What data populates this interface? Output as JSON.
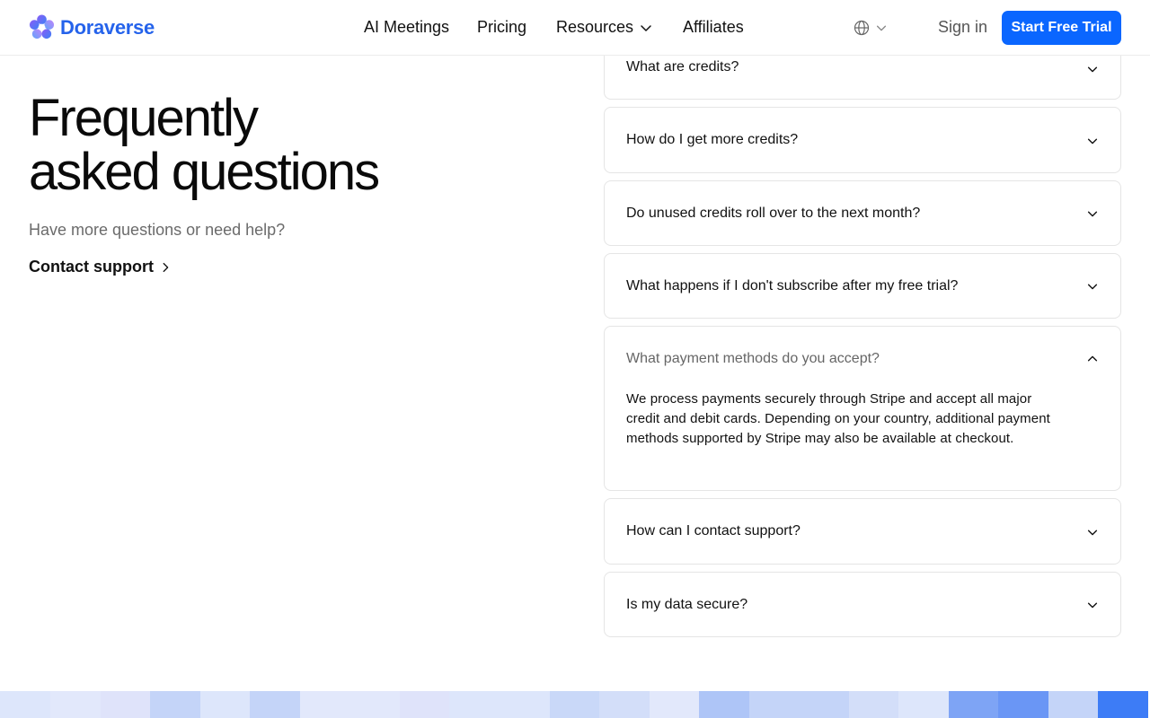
{
  "brand": {
    "name": "Doraverse",
    "color": "#2563eb"
  },
  "nav": {
    "items": [
      {
        "label": "AI Meetings"
      },
      {
        "label": "Pricing"
      },
      {
        "label": "Resources"
      },
      {
        "label": "Affiliates"
      }
    ],
    "language_icon": "globe-icon",
    "sign_in": "Sign in",
    "cta": "Start Free Trial",
    "cta_color": "#0a66ff"
  },
  "faq": {
    "title_line1": "Frequently",
    "title_line2": "asked questions",
    "help_text": "Have more questions or need help?",
    "contact_label": "Contact support",
    "items": [
      {
        "question": "What are credits?",
        "expanded": false
      },
      {
        "question": "How do I get more credits?",
        "expanded": false
      },
      {
        "question": "Do unused credits roll over to the next month?",
        "expanded": false
      },
      {
        "question": "What happens if I don't subscribe after my free trial?",
        "expanded": false
      },
      {
        "question": "What payment methods do you accept?",
        "expanded": true,
        "answer": "We process payments securely through Stripe and accept all major credit and debit cards. Depending on your country, additional payment methods supported by Stripe may also be available at checkout."
      },
      {
        "question": "How can I contact support?",
        "expanded": false
      },
      {
        "question": "Is my data secure?",
        "expanded": false
      }
    ]
  }
}
